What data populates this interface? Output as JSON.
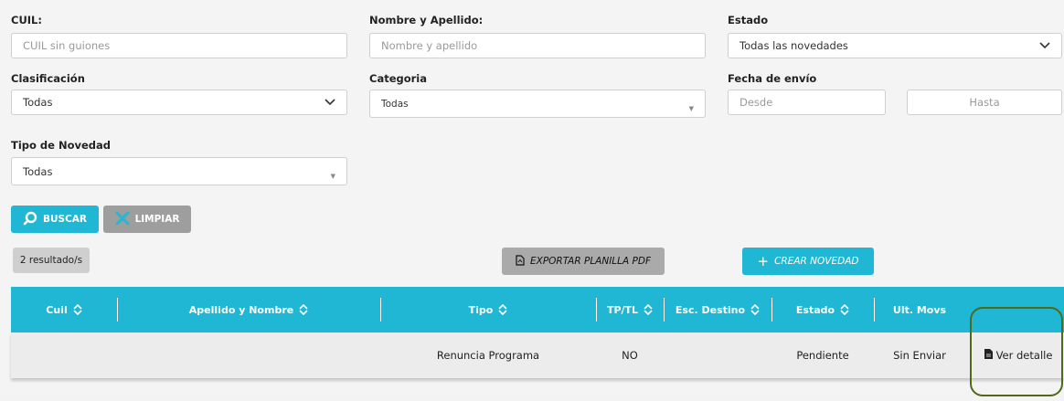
{
  "filters": {
    "cuil": {
      "label": "CUIL:",
      "placeholder": "CUIL sin guiones"
    },
    "nombre": {
      "label": "Nombre y Apellido:",
      "placeholder": "Nombre y apellido"
    },
    "estado": {
      "label": "Estado",
      "value": "Todas las novedades"
    },
    "clasificacion": {
      "label": "Clasificación",
      "value": "Todas"
    },
    "categoria": {
      "label": "Categoria",
      "value": "Todas"
    },
    "fecha_envio": {
      "label": "Fecha de envío",
      "desde": "Desde",
      "hasta": "Hasta"
    },
    "tipo_novedad": {
      "label": "Tipo de Novedad",
      "value": "Todas"
    }
  },
  "actions": {
    "buscar": "BUSCAR",
    "limpiar": "LIMPIAR",
    "resultados": "2 resultado/s",
    "exportar": "EXPORTAR PLANILLA PDF",
    "crear": "CREAR NOVEDAD"
  },
  "table": {
    "headers": [
      "Cuil",
      "Apellido y Nombre",
      "Tipo",
      "TP/TL",
      "Esc. Destino",
      "Estado",
      "Ult. Movs"
    ],
    "rows": [
      {
        "cuil": "",
        "nombre": "",
        "tipo": "Renuncia Programa",
        "tptl": "NO",
        "esc_destino": "",
        "estado": "Pendiente",
        "ult_movs": "Sin Enviar",
        "accion": "Ver detalle"
      }
    ]
  },
  "colors": {
    "accent": "#1fb7d3",
    "secondary": "#9e9e9e",
    "highlight": "#4e6a1a"
  }
}
